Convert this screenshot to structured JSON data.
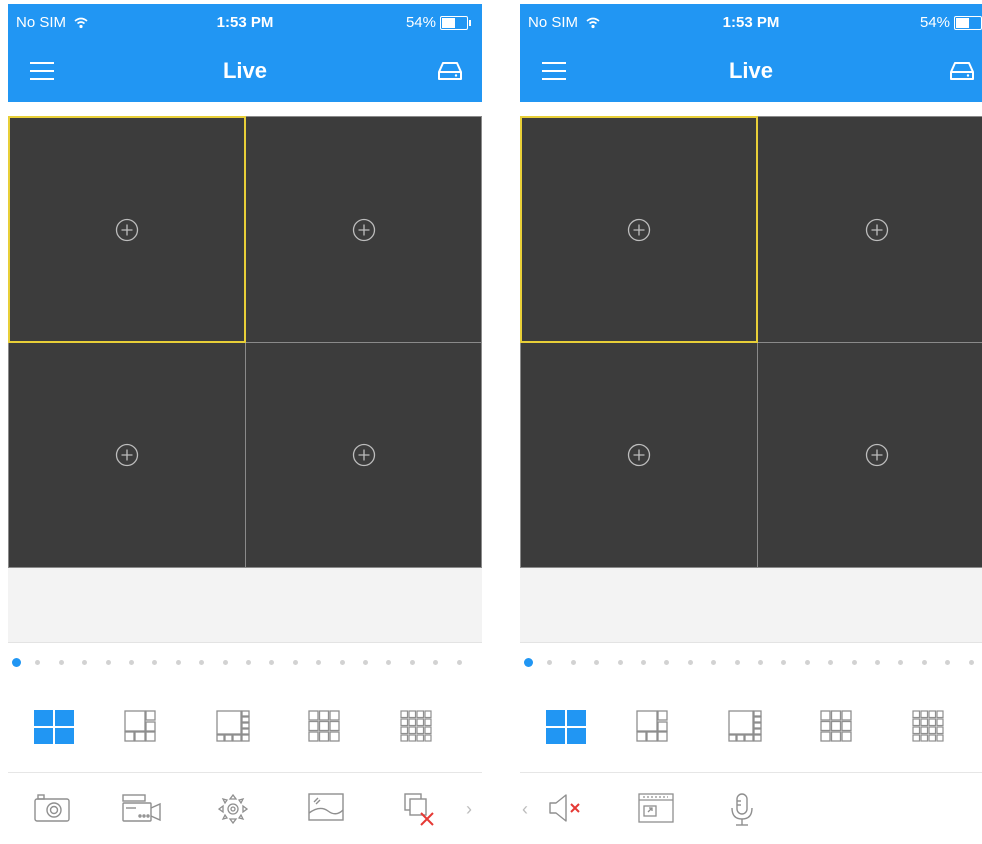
{
  "status_bar": {
    "carrier": "No SIM",
    "time": "1:53 PM",
    "battery": "54%"
  },
  "nav": {
    "title": "Live"
  },
  "grid": {
    "cells": 4,
    "selected_index": 0
  },
  "page_indicator": {
    "count": 20,
    "active_index": 0
  },
  "layouts": [
    "layout-1-icon",
    "layout-6-icon",
    "layout-8-icon",
    "layout-9-icon",
    "layout-16-icon"
  ],
  "toolbar_left": [
    "snapshot-icon",
    "record-icon",
    "ptz-icon",
    "image-adjust-icon",
    "close-all-icon"
  ],
  "toolbar_right": [
    "mute-icon",
    "fullscreen-icon",
    "microphone-icon"
  ],
  "colors": {
    "accent": "#2196f3",
    "selected_border": "#e8cf38",
    "cell_bg": "#3c3c3c",
    "close_red": "#e53935"
  }
}
